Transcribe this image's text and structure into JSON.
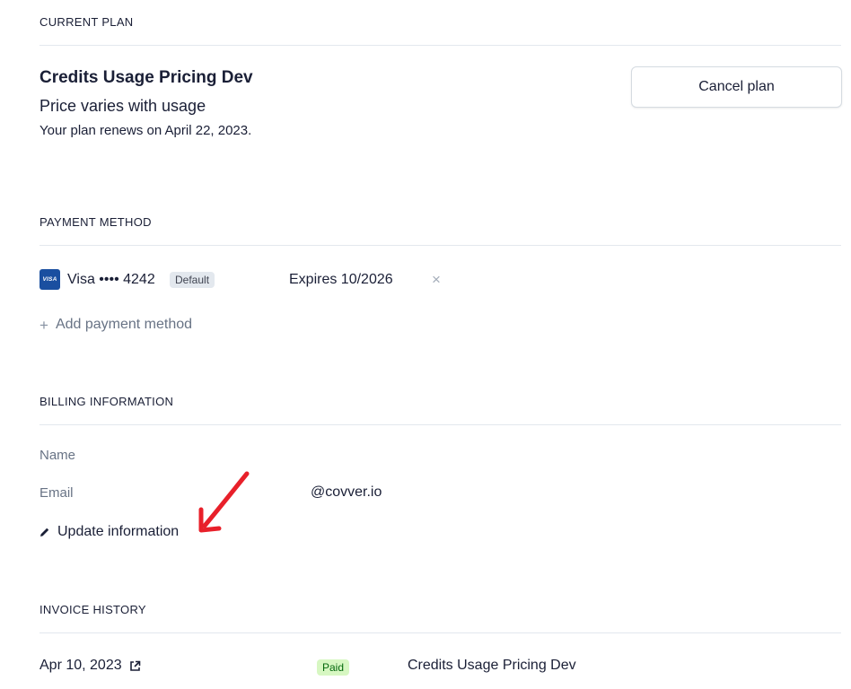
{
  "current_plan": {
    "section_title": "CURRENT PLAN",
    "plan_name": "Credits Usage Pricing Dev",
    "price_text": "Price varies with usage",
    "renewal_text": "Your plan renews on April 22, 2023.",
    "cancel_label": "Cancel plan"
  },
  "payment_method": {
    "section_title": "PAYMENT METHOD",
    "card": {
      "brand_icon": "visa-icon",
      "brand_icon_text": "VISA",
      "label": "Visa •••• 4242",
      "badge": "Default",
      "expires": "Expires 10/2026",
      "remove_icon": "×"
    },
    "add_label": "Add payment method",
    "add_icon": "+"
  },
  "billing_information": {
    "section_title": "BILLING INFORMATION",
    "name_label": "Name",
    "email_label": "Email",
    "email_value": "@covver.io",
    "update_label": "Update information"
  },
  "invoice_history": {
    "section_title": "INVOICE HISTORY",
    "invoices": [
      {
        "date": "Apr 10, 2023",
        "status": "Paid",
        "description": "Credits Usage Pricing Dev"
      }
    ]
  },
  "colors": {
    "annotation_arrow": "#e8202a",
    "paid_badge_bg": "#d7f7c2",
    "paid_badge_text": "#05690d",
    "visa_blue": "#1a4fa0"
  }
}
